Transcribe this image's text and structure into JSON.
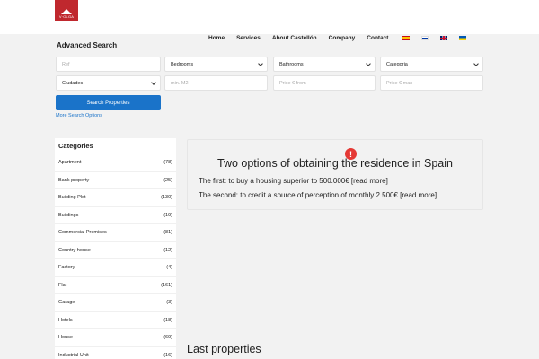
{
  "header": {
    "logo_text": "V·OLGA",
    "nav": [
      "Home",
      "Services",
      "About Castellón",
      "Company",
      "Contact"
    ]
  },
  "search": {
    "title": "Advanced Search",
    "ref_placeholder": "Ref",
    "bedrooms": "Bedrooms",
    "bathrooms": "Bathrooms",
    "categoria": "Categoria",
    "ciudades": "Ciudades",
    "m2_placeholder": "min. M2",
    "price_from_placeholder": "Price € from",
    "price_max_placeholder": "Price € max",
    "button": "Search Properties",
    "more_options": "More Search Options"
  },
  "categories": {
    "title": "Categories",
    "items": [
      {
        "name": "Apartment",
        "count": "(78)"
      },
      {
        "name": "Bank property",
        "count": "(25)"
      },
      {
        "name": "Building Plot",
        "count": "(130)"
      },
      {
        "name": "Buildings",
        "count": "(19)"
      },
      {
        "name": "Commercial Premises",
        "count": "(81)"
      },
      {
        "name": "Country house",
        "count": "(12)"
      },
      {
        "name": "Factory",
        "count": "(4)"
      },
      {
        "name": "Flat",
        "count": "(161)"
      },
      {
        "name": "Garage",
        "count": "(3)"
      },
      {
        "name": "Hotels",
        "count": "(18)"
      },
      {
        "name": "House",
        "count": "(69)"
      },
      {
        "name": "Industrial Unit",
        "count": "(16)"
      }
    ]
  },
  "info": {
    "title": "Two options of obtaining the residence in Spain",
    "line1": "The first: to buy a housing superior to 500.000€ [read more]",
    "line2": "The second: to credit a source of perception of monthly 2.500€ [read more]",
    "alert_symbol": "!"
  },
  "last_properties": "Last properties"
}
